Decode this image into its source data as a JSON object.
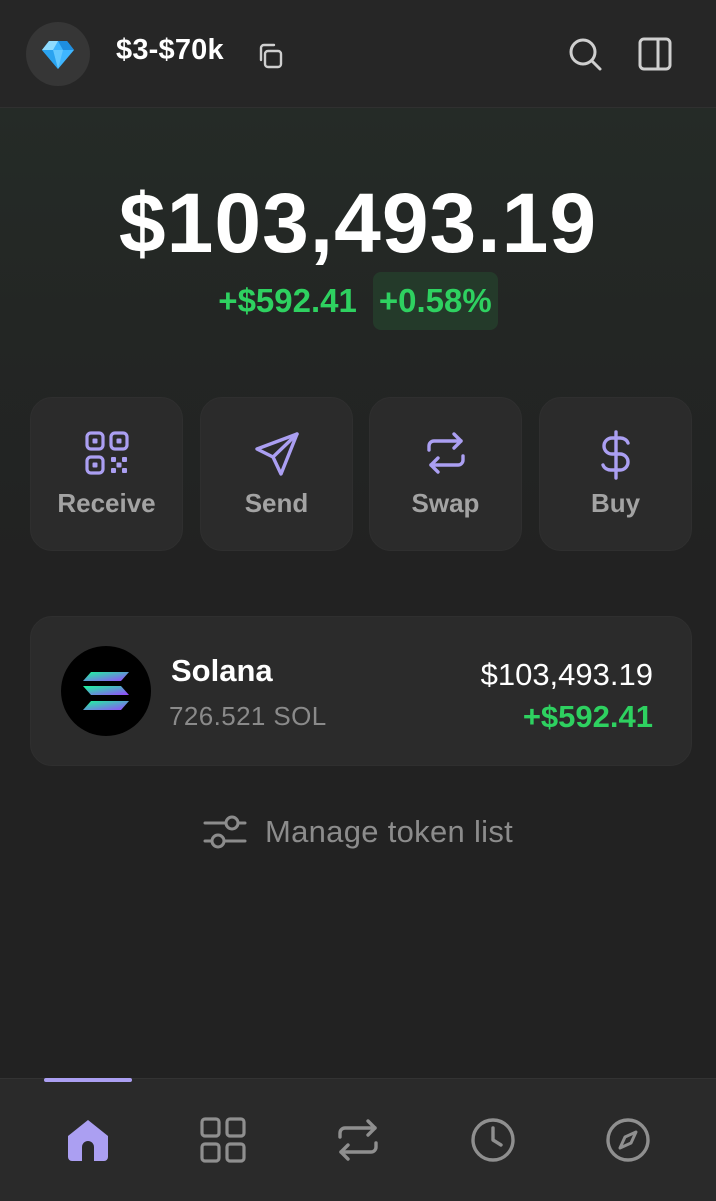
{
  "header": {
    "account_name": "$3-$70k",
    "avatar_icon": "gem-icon",
    "copy_icon": "copy-icon",
    "search_icon": "search-icon",
    "panel_icon": "side-panel-icon"
  },
  "balance": {
    "total": "$103,493.19",
    "change_abs": "+$592.41",
    "change_pct": "+0.58%"
  },
  "actions": [
    {
      "label": "Receive",
      "icon": "qr-code-icon"
    },
    {
      "label": "Send",
      "icon": "paper-plane-icon"
    },
    {
      "label": "Swap",
      "icon": "swap-arrows-icon"
    },
    {
      "label": "Buy",
      "icon": "dollar-icon"
    }
  ],
  "tokens": [
    {
      "name": "Solana",
      "amount": "726.521 SOL",
      "value": "$103,493.19",
      "change": "+$592.41",
      "icon": "solana-logo-icon"
    }
  ],
  "manage": {
    "label": "Manage token list",
    "icon": "sliders-icon"
  },
  "tabs": [
    {
      "name": "home",
      "icon": "home-icon",
      "active": true
    },
    {
      "name": "collectibles",
      "icon": "grid-icon",
      "active": false
    },
    {
      "name": "swap",
      "icon": "swap-arrows-icon",
      "active": false
    },
    {
      "name": "activity",
      "icon": "clock-icon",
      "active": false
    },
    {
      "name": "explore",
      "icon": "compass-icon",
      "active": false
    }
  ],
  "colors": {
    "accent": "#ab9ff2",
    "positive": "#2ed160",
    "background": "#222222",
    "card": "#2b2b2b"
  }
}
